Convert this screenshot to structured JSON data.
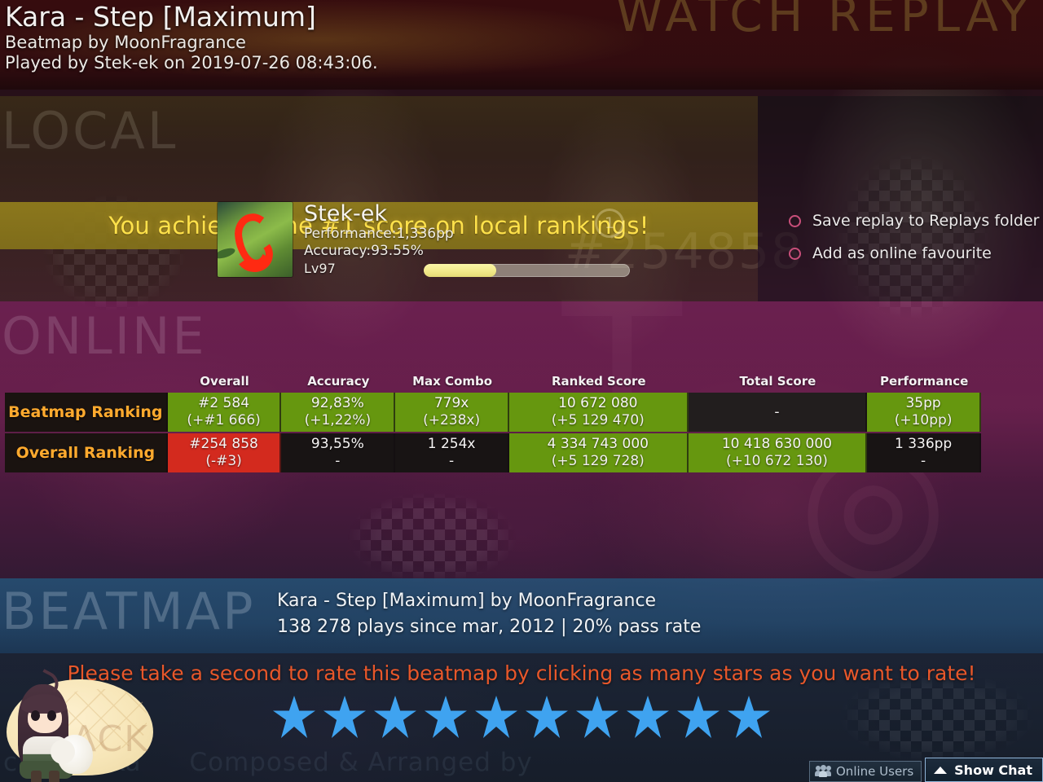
{
  "header": {
    "song_title": "Kara - Step [Maximum]",
    "beatmap_by": "Beatmap by MoonFragrance",
    "played_by": "Played by Stek-ek on 2019-07-26 08:43:06.",
    "watermark_watch_replay": "WATCH REPLAY"
  },
  "local": {
    "watermark": "LOCAL",
    "achievement": "You achieved the #1 score on local rankings!",
    "player": {
      "name": "Stek-ek",
      "performance": "Performance:1,336pp",
      "accuracy": "Accuracy:93.55%",
      "level": "Lv97",
      "level_progress_percent": 35,
      "rank_badge": "1",
      "watermark_rank_number": "#254858"
    }
  },
  "options": {
    "items": [
      {
        "label": "Save replay to Replays folder"
      },
      {
        "label": "Add as online favourite"
      }
    ]
  },
  "online": {
    "watermark": "ONLINE"
  },
  "ranking_table": {
    "columns": [
      "",
      "Overall",
      "Accuracy",
      "Max Combo",
      "Ranked Score",
      "Total Score",
      "Performance"
    ],
    "rows": [
      {
        "label": "Beatmap Ranking",
        "cells": [
          {
            "primary": "#2 584",
            "delta": "(+#1 666)",
            "state": "green"
          },
          {
            "primary": "92,83%",
            "delta": "(+1,22%)",
            "state": "green"
          },
          {
            "primary": "779x",
            "delta": "(+238x)",
            "state": "green"
          },
          {
            "primary": "10 672 080",
            "delta": "(+5 129 470)",
            "state": "green"
          },
          {
            "primary": "-",
            "delta": "",
            "state": "dark"
          },
          {
            "primary": "35pp",
            "delta": "(+10pp)",
            "state": "green"
          }
        ]
      },
      {
        "label": "Overall Ranking",
        "cells": [
          {
            "primary": "#254 858",
            "delta": "(-#3)",
            "state": "red"
          },
          {
            "primary": "93,55%",
            "delta": "-",
            "state": "dark"
          },
          {
            "primary": "1 254x",
            "delta": "-",
            "state": "dark"
          },
          {
            "primary": "4 334 743 000",
            "delta": "(+5 129 728)",
            "state": "green"
          },
          {
            "primary": "10 418 630 000",
            "delta": "(+10 672 130)",
            "state": "green"
          },
          {
            "primary": "1 336pp",
            "delta": "-",
            "state": "dark"
          }
        ]
      }
    ]
  },
  "beatmap": {
    "watermark": "BEATMAP",
    "title_line": "Kara - Step [Maximum] by MoonFragrance",
    "stats_line": "138 278 plays since mar, 2012 | 20% pass rate"
  },
  "rating": {
    "prompt": "Please take a second to rate this beatmap by clicking as many stars as you want to rate!",
    "star_count": 10
  },
  "mascot": {
    "watermark": "BACK"
  },
  "chatbar": {
    "online_users_label": "Online Users",
    "show_chat_label": "Show Chat"
  },
  "background_video_text": [
    "c Artist Ka",
    "Composed & Arranged by"
  ],
  "colors": {
    "green": "#66970f",
    "red": "#d32a1e",
    "gold_banner": "#927e1c",
    "gold_text": "#ffe14a",
    "orange_label": "#ffaa2e",
    "star_blue": "#3fa3f0",
    "prompt_orange": "#e8572a",
    "radio_pink": "#c94f7a"
  }
}
